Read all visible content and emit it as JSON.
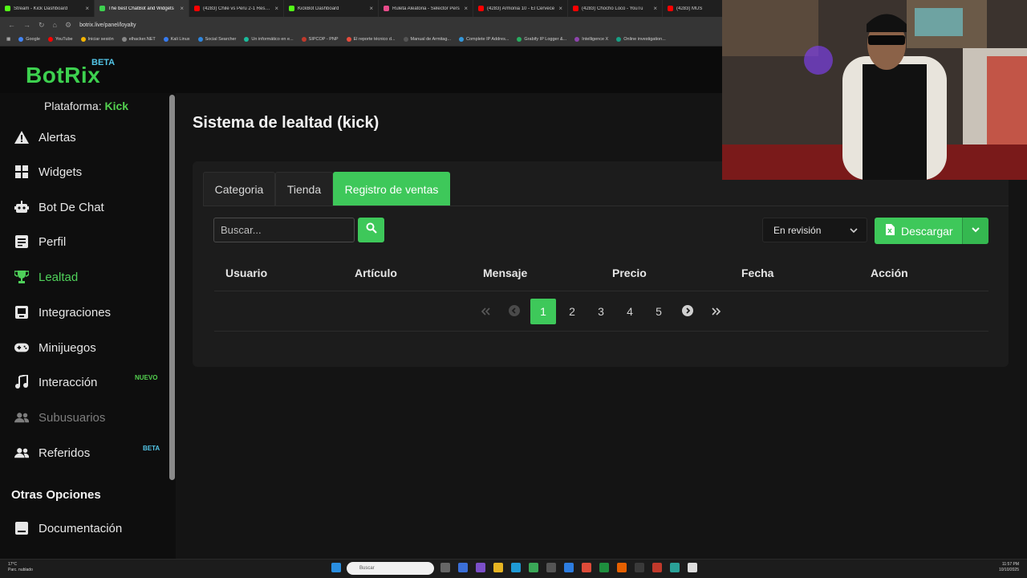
{
  "browser": {
    "tabs": [
      {
        "title": "Stream - Kick Dashboard",
        "color": "#53fc18",
        "active": false
      },
      {
        "title": "The best ChatBot and Widgets",
        "color": "#3dd14f",
        "active": true
      },
      {
        "title": "(4283) Chile vs Peru 2-1 Resum",
        "color": "#ff0000",
        "active": false
      },
      {
        "title": "KickBot Dashboard",
        "color": "#53fc18",
        "active": false
      },
      {
        "title": "Ruleta Aleatoria - Selector Pers",
        "color": "#e84c8b",
        "active": false
      },
      {
        "title": "(4283) Armonia 10 - El Cervece",
        "color": "#ff0000",
        "active": false
      },
      {
        "title": "(4283) Chocho Loco - YouTu",
        "color": "#ff0000",
        "active": false
      },
      {
        "title": "(4283) MUS",
        "color": "#ff0000",
        "active": false
      }
    ],
    "url": "botrix.live/panel/loyalty",
    "bookmarks": [
      "Google",
      "YouTube",
      "Iniciar sesión",
      "elhacker.NET",
      "Kali Linux",
      "Social Searcher",
      "Un informático en e...",
      "SIPCOP - PNP",
      "El reporte técnico d...",
      "Manual de Armitag...",
      "Complete IP Addres...",
      "Grabify IP Logger &...",
      "Intelligence X",
      "Online investigation..."
    ]
  },
  "app": {
    "logo": "BotRix",
    "beta": "BETA",
    "platform_label": "Plataforma:",
    "platform_value": "Kick"
  },
  "sidebar": {
    "items": [
      {
        "label": "Alertas",
        "icon": "warning-icon"
      },
      {
        "label": "Widgets",
        "icon": "grid-icon"
      },
      {
        "label": "Bot De Chat",
        "icon": "robot-icon"
      },
      {
        "label": "Perfil",
        "icon": "profile-icon"
      },
      {
        "label": "Lealtad",
        "icon": "trophy-icon"
      },
      {
        "label": "Integraciones",
        "icon": "integration-icon"
      },
      {
        "label": "Minijuegos",
        "icon": "gamepad-icon"
      },
      {
        "label": "Interacción",
        "icon": "music-icon",
        "badge": "NUEVO"
      },
      {
        "label": "Subusuarios",
        "icon": "users-icon"
      },
      {
        "label": "Referidos",
        "icon": "users-icon",
        "badge": "BETA"
      }
    ],
    "section": "Otras Opciones",
    "docs": "Documentación"
  },
  "page": {
    "title": "Sistema de lealtad (kick)",
    "tabs": [
      "Categoria",
      "Tienda",
      "Registro de ventas"
    ],
    "search_placeholder": "Buscar...",
    "status_select": "En revisión",
    "download": "Descargar",
    "columns": [
      "Usuario",
      "Artículo",
      "Mensaje",
      "Precio",
      "Fecha",
      "Acción"
    ],
    "pages": [
      "1",
      "2",
      "3",
      "4",
      "5"
    ]
  },
  "taskbar": {
    "temp": "17°C",
    "weather": "Parc. nublado",
    "search": "Buscar",
    "time": "11:57 PM",
    "date": "10/10/2025"
  },
  "colors": {
    "accent": "#3ec85a",
    "beta": "#53c6e8"
  }
}
